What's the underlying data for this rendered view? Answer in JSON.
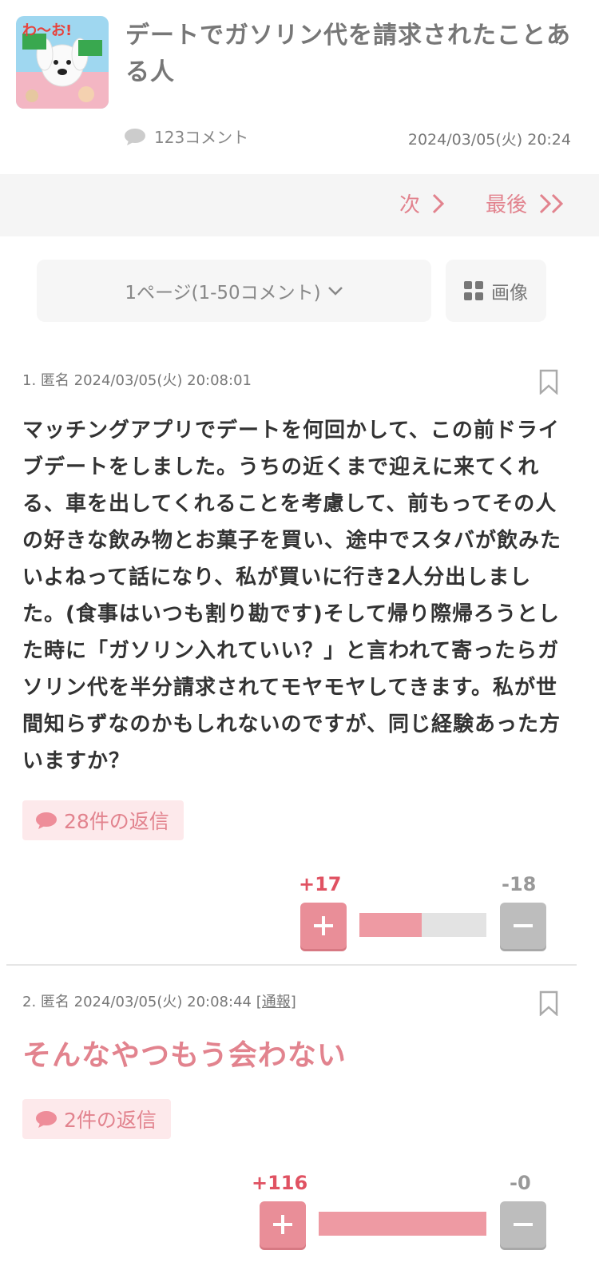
{
  "topic": {
    "title": "デートでガソリン代を請求されたことある人",
    "comment_count": "123コメント",
    "date": "2024/03/05(火) 20:24",
    "thumbnail_text": "わ〜お!"
  },
  "pager": {
    "next_label": "次",
    "last_label": "最後"
  },
  "page_select": {
    "label": "1ページ(1-50コメント)",
    "arrow": "⌄"
  },
  "image_button": {
    "label": "画像"
  },
  "comments": [
    {
      "meta": "1. 匿名 2024/03/05(火) 20:08:01",
      "report": "",
      "body": "マッチングアプリでデートを何回かして、この前ドライブデートをしました。うちの近くまで迎えに来てくれる、車を出してくれることを考慮して、前もってその人の好きな飲み物とお菓子を買い、途中でスタバが飲みたいよねって話になり、私が買いに行き2人分出しました。(食事はいつも割り勘です)そして帰り際帰ろうとした時に「ガソリン入れていい？」と言われて寄ったらガソリン代を半分請求されてモヤモヤしてきます。私が世間知らずなのかもしれないのですが、同じ経験あった方いますか？",
      "replies": "28件の返信",
      "plus": "+17",
      "minus": "-18",
      "plus_ratio": 0.49
    },
    {
      "meta": "2. 匿名 2024/03/05(火) 20:08:44",
      "report": "[通報]",
      "body": "そんなやつもう会わない",
      "replies": "2件の返信",
      "plus": "+116",
      "minus": "-0",
      "plus_ratio": 1.0
    }
  ],
  "colors": {
    "accent": "#e2838e",
    "plus": "#e05262",
    "minus": "#999999"
  }
}
